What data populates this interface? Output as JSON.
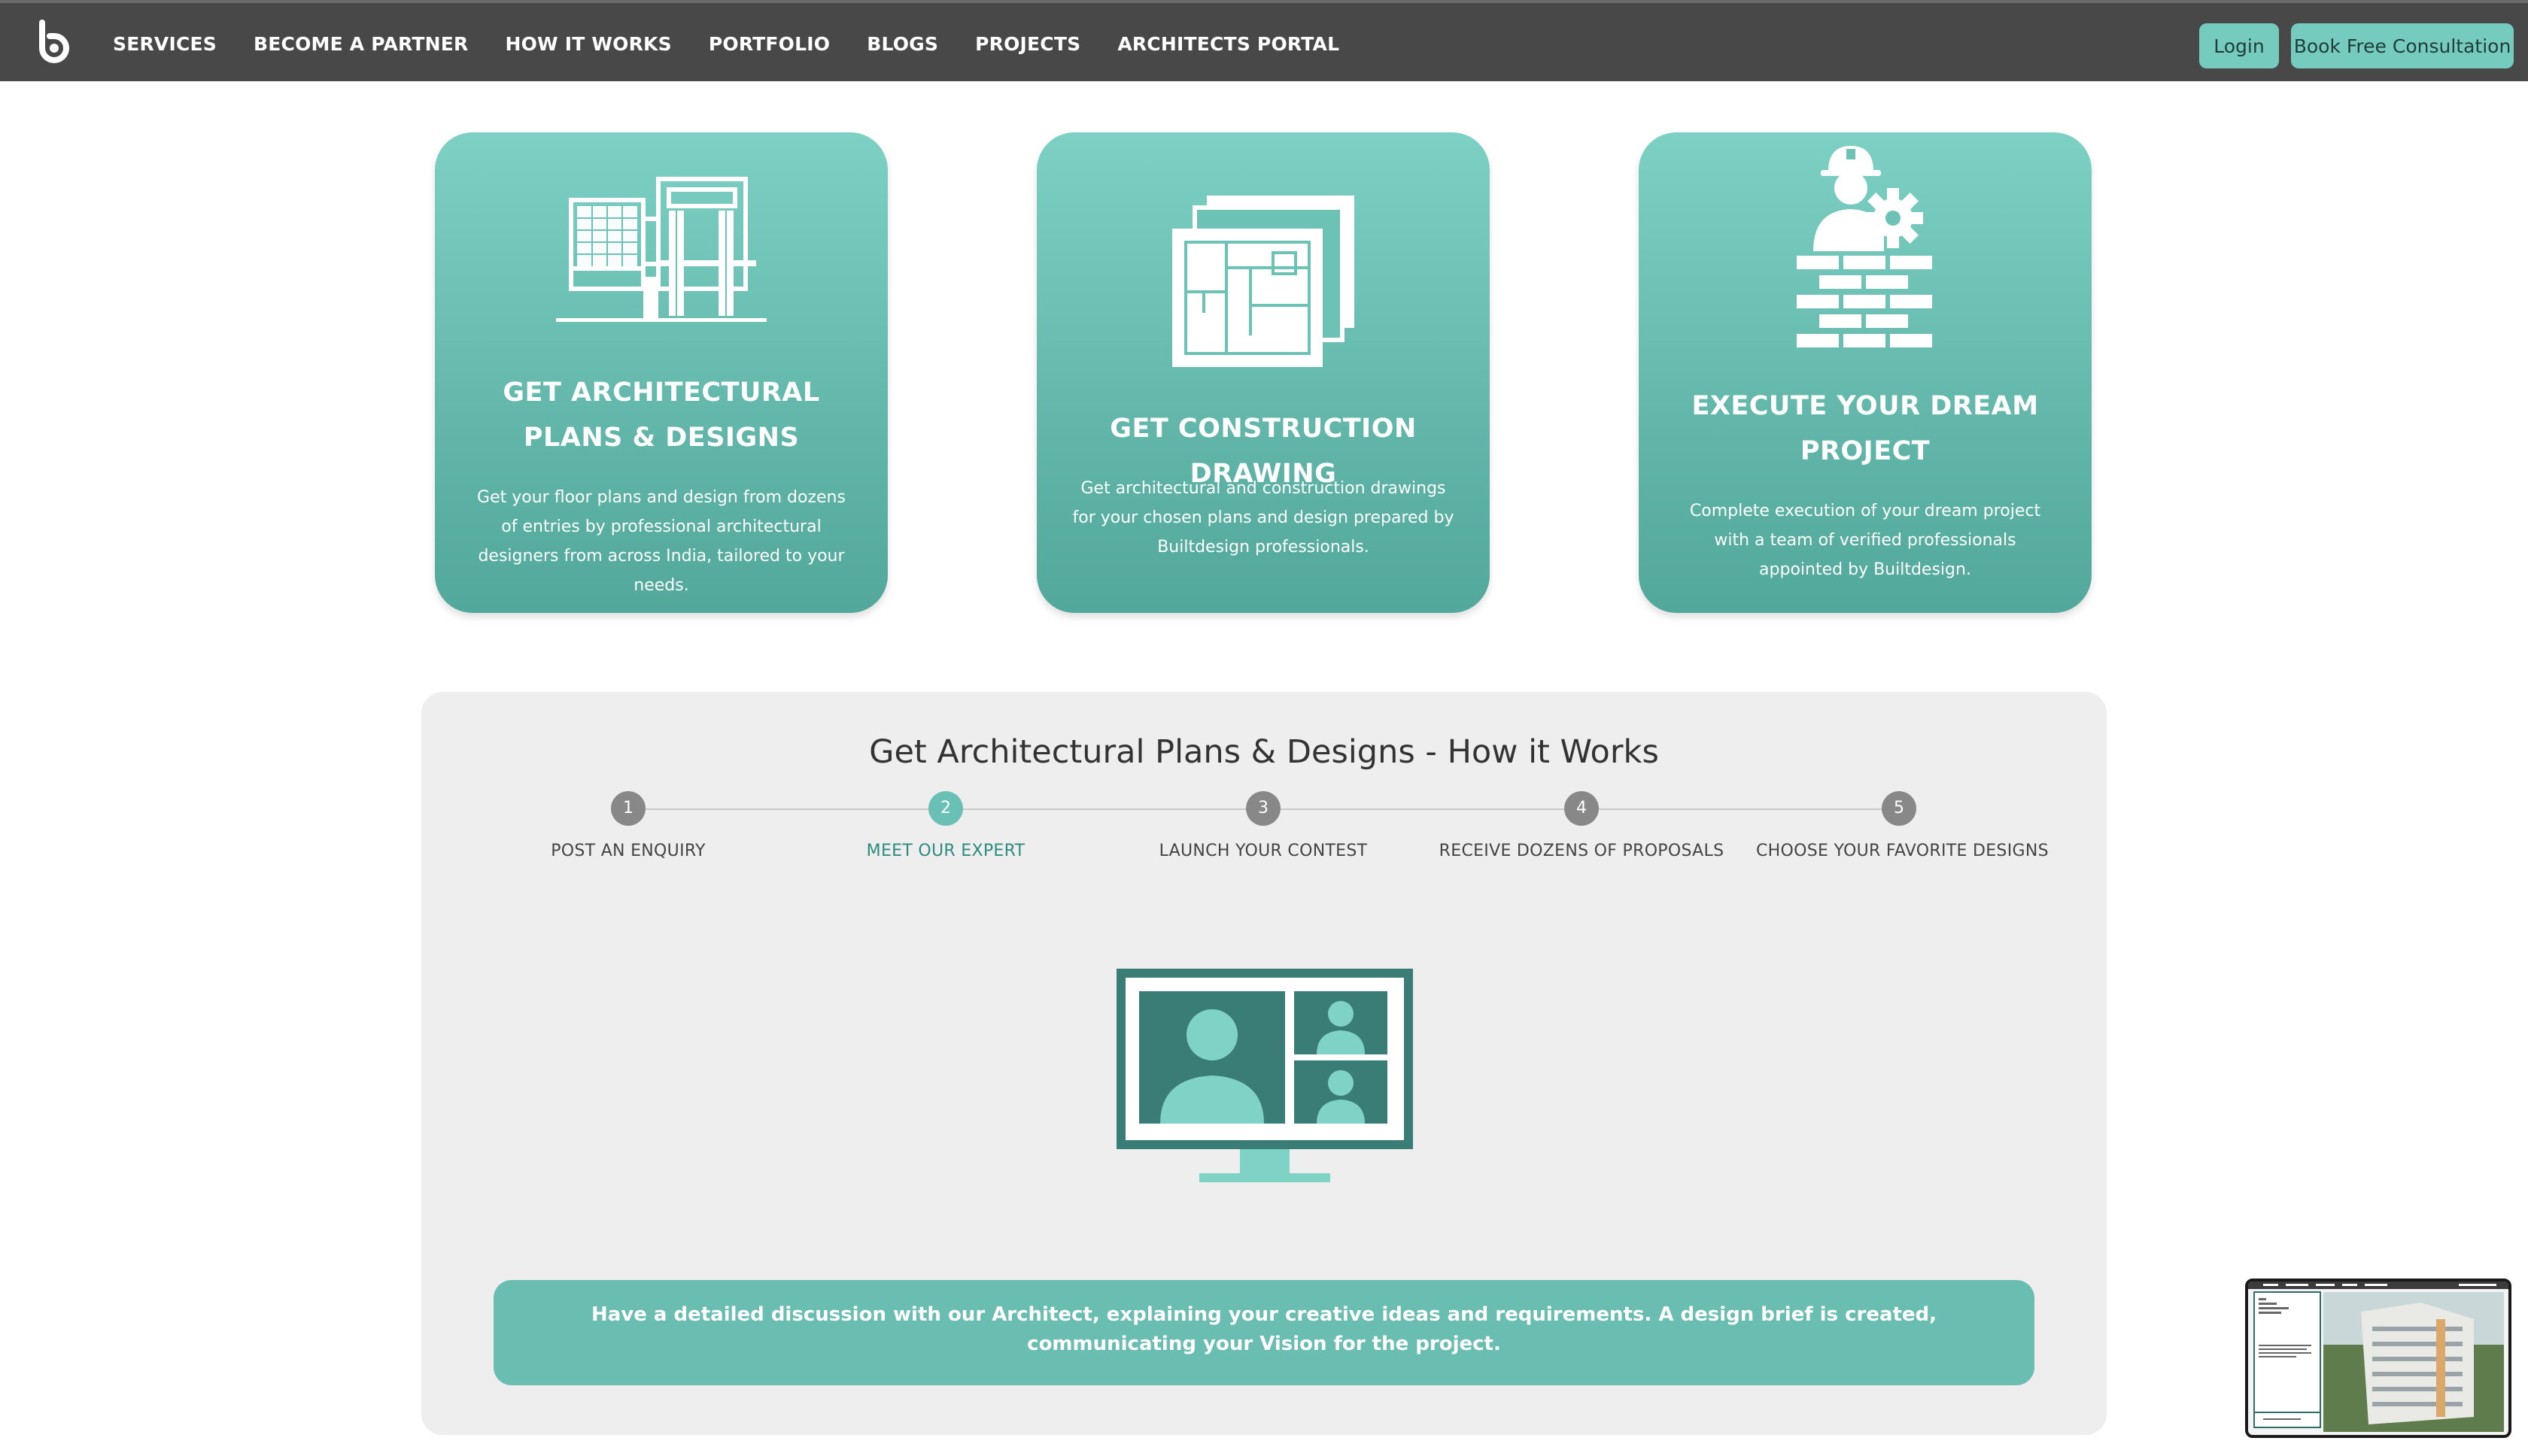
{
  "nav": {
    "links": [
      "SERVICES",
      "BECOME A PARTNER",
      "HOW IT WORKS",
      "PORTFOLIO",
      "BLOGS",
      "PROJECTS",
      "ARCHITECTS PORTAL"
    ],
    "login_label": "Login",
    "consult_label": "Book Free Consultation",
    "logo_icon": "builtdesign-logo"
  },
  "cards": [
    {
      "icon": "building-plan-icon",
      "title": "GET ARCHITECTURAL PLANS & DESIGNS",
      "description": "Get your floor plans and design from dozens of entries by professional architectural designers from across India, tailored to your needs."
    },
    {
      "icon": "construction-drawing-icon",
      "title": "GET CONSTRUCTION DRAWING",
      "description": "Get architectural and construction drawings for your chosen plans and design prepared by Builtdesign professionals."
    },
    {
      "icon": "worker-bricks-icon",
      "title": "EXECUTE YOUR DREAM PROJECT",
      "description": "Complete execution of your dream project with a team of verified professionals appointed by Builtdesign."
    }
  ],
  "how_it_works": {
    "title": "Get Architectural Plans & Designs - How it Works",
    "active_step": 2,
    "steps": [
      {
        "number": "1",
        "label": "POST AN ENQUIRY"
      },
      {
        "number": "2",
        "label": "MEET OUR EXPERT"
      },
      {
        "number": "3",
        "label": "LAUNCH YOUR CONTEST"
      },
      {
        "number": "4",
        "label": "RECEIVE DOZENS OF PROPOSALS"
      },
      {
        "number": "5",
        "label": "CHOOSE YOUR FAVORITE DESIGNS"
      }
    ],
    "illustration_icon": "video-call-monitor-icon",
    "description": "Have a detailed discussion with our Architect, explaining your creative ideas and requirements. A design brief is created, communicating your Vision for the project."
  },
  "colors": {
    "nav_bg": "#484848",
    "accent": "#76cbbf",
    "card_top": "#7dd0c4",
    "card_bottom": "#52a89b",
    "panel_bg": "#eeeeee",
    "active_step": "#6ac0b4",
    "inactive_step": "#888888"
  }
}
